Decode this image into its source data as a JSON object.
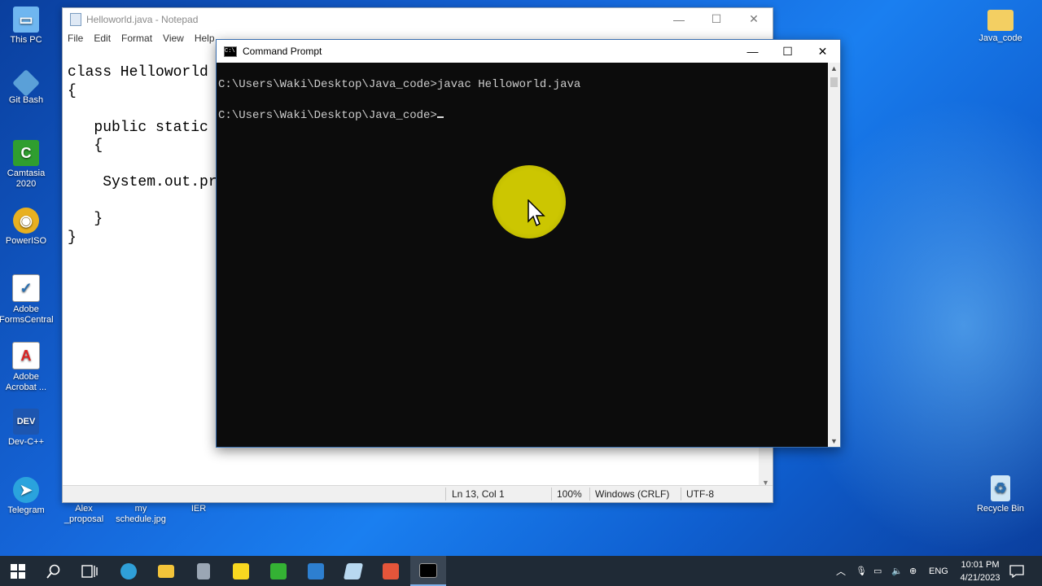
{
  "desktop": {
    "left_icons": [
      {
        "label": "This PC",
        "icon": "computer-icon",
        "color": "#6fb6f0"
      },
      {
        "label": "Git Bash",
        "icon": "git-bash-icon",
        "color": "#5aa0d8"
      },
      {
        "label": "Camtasia 2020",
        "icon": "camtasia-icon",
        "color": "#2f9e2f"
      },
      {
        "label": "PowerISO",
        "icon": "poweriso-icon",
        "color": "#e8b020"
      },
      {
        "label": "Adobe FormsCentral",
        "icon": "forms-central-icon",
        "color": "#ffffff"
      },
      {
        "label": "Adobe Acrobat ...",
        "icon": "acrobat-icon",
        "color": "#ffffff"
      },
      {
        "label": "Dev-C++",
        "icon": "devcpp-icon",
        "color": "#1d56b0"
      },
      {
        "label": "Telegram",
        "icon": "telegram-icon",
        "color": "#2aa3dd"
      }
    ],
    "bottom_icons": [
      {
        "label": "Alex _proposal"
      },
      {
        "label": "my schedule.jpg"
      },
      {
        "label": "IER"
      }
    ],
    "right_icons": [
      {
        "label": "Java_code",
        "icon": "folder-icon",
        "color": "#f3cf62"
      },
      {
        "label": "Recycle Bin",
        "icon": "recycle-bin-icon",
        "color": "#cfe6f5"
      }
    ]
  },
  "notepad": {
    "title": "Helloworld.java - Notepad",
    "menu": [
      "File",
      "Edit",
      "Format",
      "View",
      "Help"
    ],
    "content": "class Helloworld\n{\n\n   public static\n   {\n\n    System.out.pr\n\n   }\n}",
    "status": {
      "position": "Ln 13, Col 1",
      "zoom": "100%",
      "line_ending": "Windows (CRLF)",
      "encoding": "UTF-8"
    }
  },
  "cmd": {
    "title": "Command Prompt",
    "line1": "C:\\Users\\Waki\\Desktop\\Java_code>javac Helloworld.java",
    "line2": "C:\\Users\\Waki\\Desktop\\Java_code>"
  },
  "taskbar": {
    "apps": [
      {
        "icon": "start-icon"
      },
      {
        "icon": "search-icon"
      },
      {
        "icon": "task-view-icon"
      },
      {
        "icon": "edge-icon",
        "color": "#2f9fd8"
      },
      {
        "icon": "file-explorer-icon",
        "color": "#f3c43a"
      },
      {
        "icon": "calculator-icon",
        "color": "#9aa6b4"
      },
      {
        "icon": "sticky-notes-icon",
        "color": "#f8d820"
      },
      {
        "icon": "camtasia-icon",
        "color": "#34b234"
      },
      {
        "icon": "video-editor-icon",
        "color": "#2d7fd0"
      },
      {
        "icon": "notepad-icon",
        "color": "#b8d8f0"
      },
      {
        "icon": "camtasia-recorder-icon",
        "color": "#e4553a"
      },
      {
        "icon": "command-prompt-icon",
        "color": "#000000"
      }
    ],
    "language": "ENG",
    "time": "10:01 PM",
    "date": "4/21/2023"
  }
}
